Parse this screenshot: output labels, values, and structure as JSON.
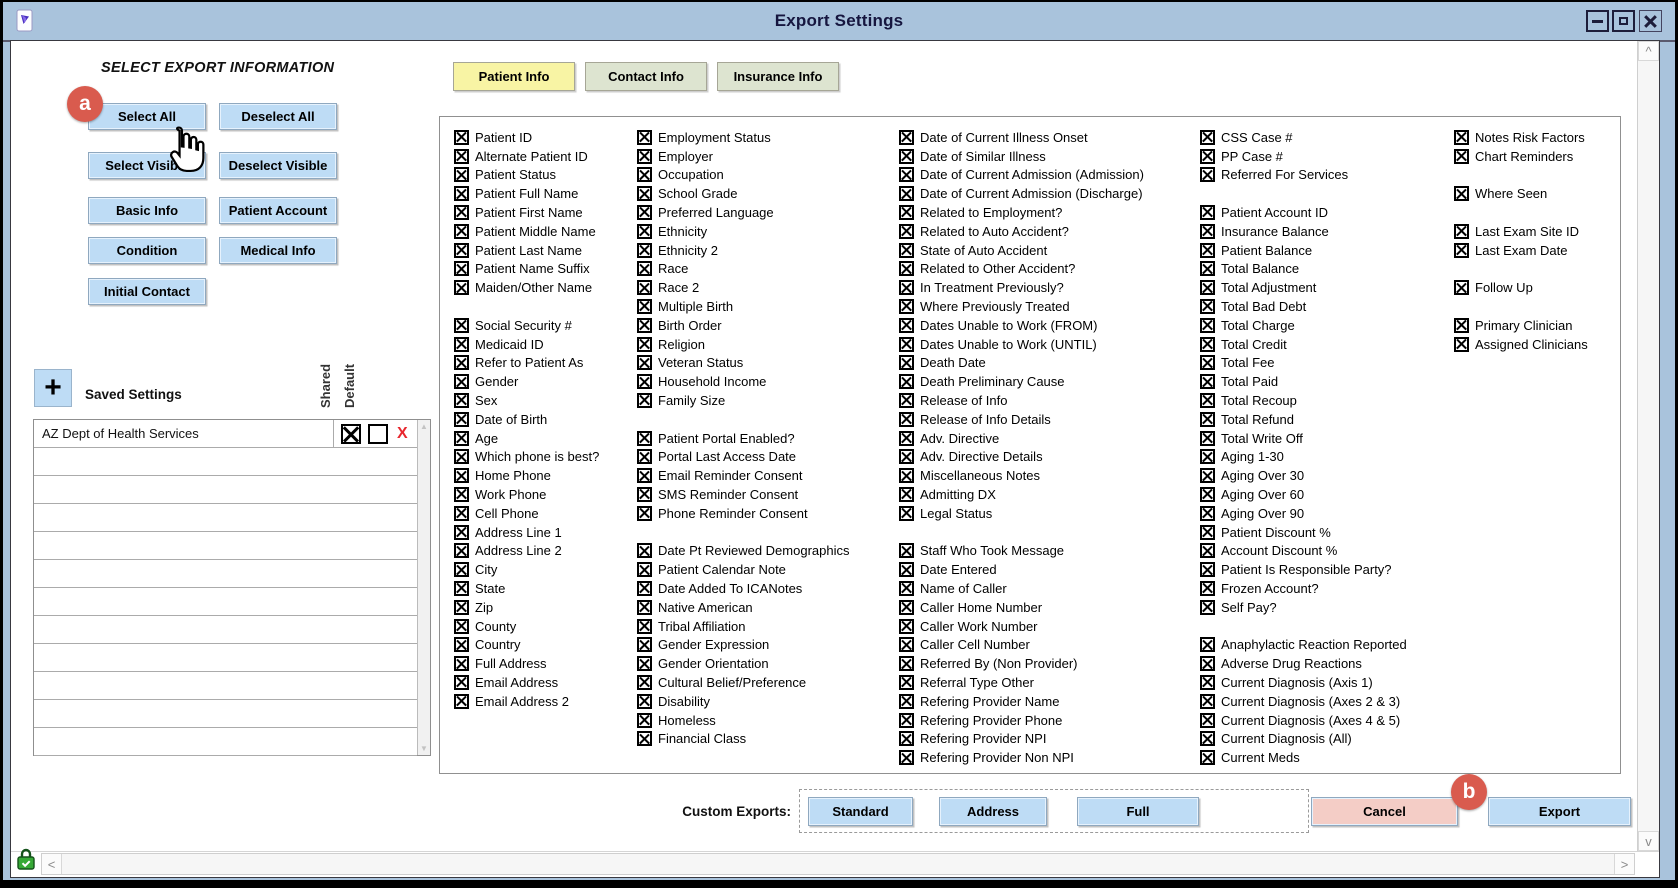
{
  "colors": {
    "titlebar-bg": "#a9c3dc",
    "title-text": "#16163f",
    "button-bg": "#bedcf5",
    "button-border": "#8fa8bf",
    "tab-active-bg": "#f8f4a4",
    "tab-inactive-bg": "#dde4d0",
    "cancel-bg": "#f4cdc6",
    "badge-bg": "#d95b4e",
    "delete-x": "#e8272e"
  },
  "window": {
    "title": "Export Settings"
  },
  "icons": {
    "up_arrow": "^",
    "down_arrow": "v",
    "left_arrow": "<",
    "right_arrow": ">",
    "list_up": "▲",
    "list_down": "▼",
    "plus": "+"
  },
  "badges": {
    "a": "a",
    "b": "b"
  },
  "left_panel": {
    "heading": "SELECT EXPORT INFORMATION",
    "buttons": [
      "Select All",
      "Deselect All",
      "Select Visible",
      "Deselect Visible",
      "Basic Info",
      "Patient Account",
      "Condition",
      "Medical Info",
      "Initial Contact"
    ]
  },
  "saved_settings": {
    "title": "Saved Settings",
    "shared_column_label": "Shared",
    "default_column_label": "Default",
    "delete_label": "X",
    "rows": [
      {
        "name": "AZ Dept of Health Services",
        "shared": true,
        "default": false
      }
    ],
    "empty_rows": [
      "",
      "",
      "",
      "",
      "",
      "",
      "",
      "",
      "",
      "",
      ""
    ]
  },
  "tabs": [
    {
      "label": "Patient Info",
      "active": true
    },
    {
      "label": "Contact Info",
      "active": false
    },
    {
      "label": "Insurance Info",
      "active": false
    }
  ],
  "fields": {
    "col1": [
      "Patient ID",
      "Alternate Patient ID",
      "Patient Status",
      "Patient Full Name",
      "Patient First Name",
      "Patient Middle Name",
      "Patient Last Name",
      "Patient Name Suffix",
      "Maiden/Other Name",
      "",
      "Social Security #",
      "Medicaid ID",
      "Refer to Patient As",
      "Gender",
      "Sex",
      "Date of Birth",
      "Age",
      "Which phone is best?",
      "Home Phone",
      "Work Phone",
      "Cell Phone",
      "Address Line 1",
      "Address Line 2",
      "City",
      "State",
      "Zip",
      "County",
      "Country",
      "Full Address",
      "Email Address",
      "Email Address 2"
    ],
    "col2": [
      "Employment Status",
      "Employer",
      "Occupation",
      "School Grade",
      "Preferred Language",
      "Ethnicity",
      "Ethnicity 2",
      "Race",
      "Race 2",
      "Multiple Birth",
      "Birth Order",
      "Religion",
      "Veteran Status",
      "Household Income",
      "Family Size",
      "",
      "Patient Portal Enabled?",
      "Portal Last Access Date",
      "Email Reminder Consent",
      "SMS Reminder Consent",
      "Phone Reminder Consent",
      "",
      "Date Pt Reviewed Demographics",
      "Patient Calendar Note",
      "Date Added To ICANotes",
      "Native American",
      "Tribal Affiliation",
      "Gender Expression",
      "Gender Orientation",
      "Cultural Belief/Preference",
      "Disability",
      "Homeless",
      "Financial Class"
    ],
    "col3": [
      "Date of Current Illness Onset",
      "Date of Similar Illness",
      "Date of Current Admission (Admission)",
      "Date of Current Admission (Discharge)",
      "Related to Employment?",
      "Related to Auto Accident?",
      "State of Auto Accident",
      "Related to Other Accident?",
      "In Treatment Previously?",
      "Where Previously Treated",
      "Dates Unable to Work (FROM)",
      "Dates Unable to Work (UNTIL)",
      "Death Date",
      "Death Preliminary Cause",
      "Release of Info",
      "Release of Info Details",
      "Adv. Directive",
      "Adv. Directive Details",
      "Miscellaneous Notes",
      "Admitting DX",
      "Legal Status",
      "",
      "Staff Who Took Message",
      "Date Entered",
      "Name of Caller",
      "Caller Home Number",
      "Caller Work Number",
      "Caller Cell Number",
      "Referred By (Non Provider)",
      "Referral Type Other",
      "Refering Provider Name",
      "Refering Provider Phone",
      "Refering Provider NPI",
      "Refering Provider Non NPI"
    ],
    "col4": [
      "CSS Case #",
      "PP Case #",
      "Referred For Services",
      "",
      "Patient Account ID",
      "Insurance Balance",
      "Patient Balance",
      "Total Balance",
      "Total Adjustment",
      "Total Bad Debt",
      "Total Charge",
      "Total Credit",
      "Total Fee",
      "Total Paid",
      "Total Recoup",
      "Total Refund",
      "Total Write Off",
      "Aging 1-30",
      "Aging Over 30",
      "Aging Over 60",
      "Aging Over 90",
      "Patient Discount %",
      "Account Discount %",
      "Patient Is Responsible Party?",
      "Frozen Account?",
      "Self Pay?",
      "",
      "Anaphylactic Reaction Reported",
      "Adverse Drug Reactions",
      "Current Diagnosis (Axis 1)",
      "Current Diagnosis (Axes 2 & 3)",
      "Current Diagnosis (Axes 4 & 5)",
      "Current Diagnosis (All)",
      "Current Meds"
    ],
    "col5": [
      "Notes Risk Factors",
      "Chart Reminders",
      "",
      "Where Seen",
      "",
      "Last Exam Site ID",
      "Last Exam Date",
      "",
      "Follow Up",
      "",
      "Primary Clinician",
      "Assigned Clinicians"
    ]
  },
  "footer": {
    "custom_exports_label": "Custom Exports:",
    "custom_export_buttons": [
      "Standard",
      "Address",
      "Full"
    ],
    "cancel_label": "Cancel",
    "export_label": "Export"
  }
}
